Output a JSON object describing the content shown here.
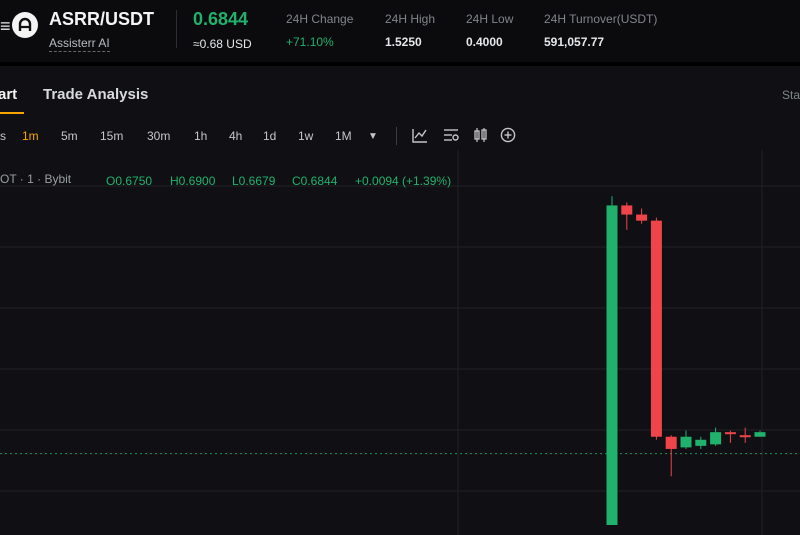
{
  "header": {
    "menu_glyph": "≡",
    "pair": "ASRR/USDT",
    "token_name": "Assisterr AI",
    "last_price": "0.6844",
    "fiat_price": "≈0.68 USD",
    "stats": [
      {
        "label": "24H Change",
        "value": "+71.10%"
      },
      {
        "label": "24H High",
        "value": "1.5250"
      },
      {
        "label": "24H Low",
        "value": "0.4000"
      },
      {
        "label": "24H Turnover(USDT)",
        "value": "591,057.77"
      }
    ]
  },
  "tabs": {
    "chart": "art",
    "trade_analysis": "Trade Analysis",
    "standard": "Sta"
  },
  "toolbar": {
    "intervals": [
      "s",
      "1m",
      "5m",
      "15m",
      "30m",
      "1h",
      "4h",
      "1d",
      "1w",
      "1M"
    ],
    "active_interval": "1m",
    "dropdown_glyph": "▼",
    "tool_icons": [
      "indicators-icon",
      "chart-settings-icon",
      "candle-type-icon",
      "add-icon"
    ]
  },
  "legend": {
    "source": "OT · 1 · Bybit",
    "open": "O0.6750",
    "high": "H0.6900",
    "low": "L0.6679",
    "close": "C0.6844",
    "change": "+0.0094 (+1.39%)"
  },
  "colors": {
    "up": "#20b26c",
    "down": "#ef454a",
    "accent": "#f7a600",
    "background": "#101014"
  },
  "chart_data": {
    "type": "candlestick",
    "y_range": [
      0.45,
      1.6
    ],
    "current_price": 0.6844,
    "candles": [
      {
        "open": 0.45,
        "close": 1.5,
        "high": 1.53,
        "low": 0.45
      },
      {
        "open": 1.5,
        "close": 1.47,
        "high": 1.51,
        "low": 1.42
      },
      {
        "open": 1.47,
        "close": 1.45,
        "high": 1.49,
        "low": 1.44
      },
      {
        "open": 1.45,
        "close": 0.74,
        "high": 1.46,
        "low": 0.73
      },
      {
        "open": 0.74,
        "close": 0.7,
        "high": 0.745,
        "low": 0.61
      },
      {
        "open": 0.705,
        "close": 0.74,
        "high": 0.76,
        "low": 0.7
      },
      {
        "open": 0.71,
        "close": 0.73,
        "high": 0.74,
        "low": 0.7
      },
      {
        "open": 0.715,
        "close": 0.755,
        "high": 0.77,
        "low": 0.71
      },
      {
        "open": 0.755,
        "close": 0.75,
        "high": 0.76,
        "low": 0.72
      },
      {
        "open": 0.745,
        "close": 0.74,
        "high": 0.77,
        "low": 0.72
      },
      {
        "open": 0.74,
        "close": 0.755,
        "high": 0.76,
        "low": 0.74
      }
    ]
  }
}
